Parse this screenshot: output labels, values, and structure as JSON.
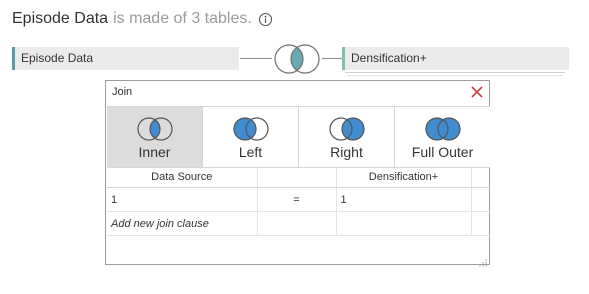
{
  "header": {
    "datasource_name": "Episode Data",
    "subtitle": "is made of 3 tables.",
    "info_icon": "info-icon"
  },
  "canvas": {
    "left_table": "Episode Data",
    "right_table": "Densification+",
    "join_icon": "inner-join-venn-icon"
  },
  "join_dialog": {
    "title": "Join",
    "close_icon": "close-x-icon",
    "selected_type": "Inner",
    "join_types": [
      {
        "label": "Inner",
        "icon": "inner-join-icon"
      },
      {
        "label": "Left",
        "icon": "left-join-icon"
      },
      {
        "label": "Right",
        "icon": "right-join-icon"
      },
      {
        "label": "Full Outer",
        "icon": "full-outer-join-icon"
      }
    ],
    "columns": {
      "left": "Data Source",
      "op": "",
      "right": "Densification+",
      "extra": ""
    },
    "clauses": [
      {
        "left": "1",
        "op": "=",
        "right": "1"
      }
    ],
    "add_clause_placeholder": "Add new join clause"
  },
  "colors": {
    "accent_blue": "#3f8dd0",
    "left_table_bar": "#5b9aa5",
    "right_table_bar": "#7fc0a6",
    "selected_bg": "#dcdcdc",
    "close_red": "#c8453a",
    "canvas_venn_fill": "#6aa9b6"
  }
}
